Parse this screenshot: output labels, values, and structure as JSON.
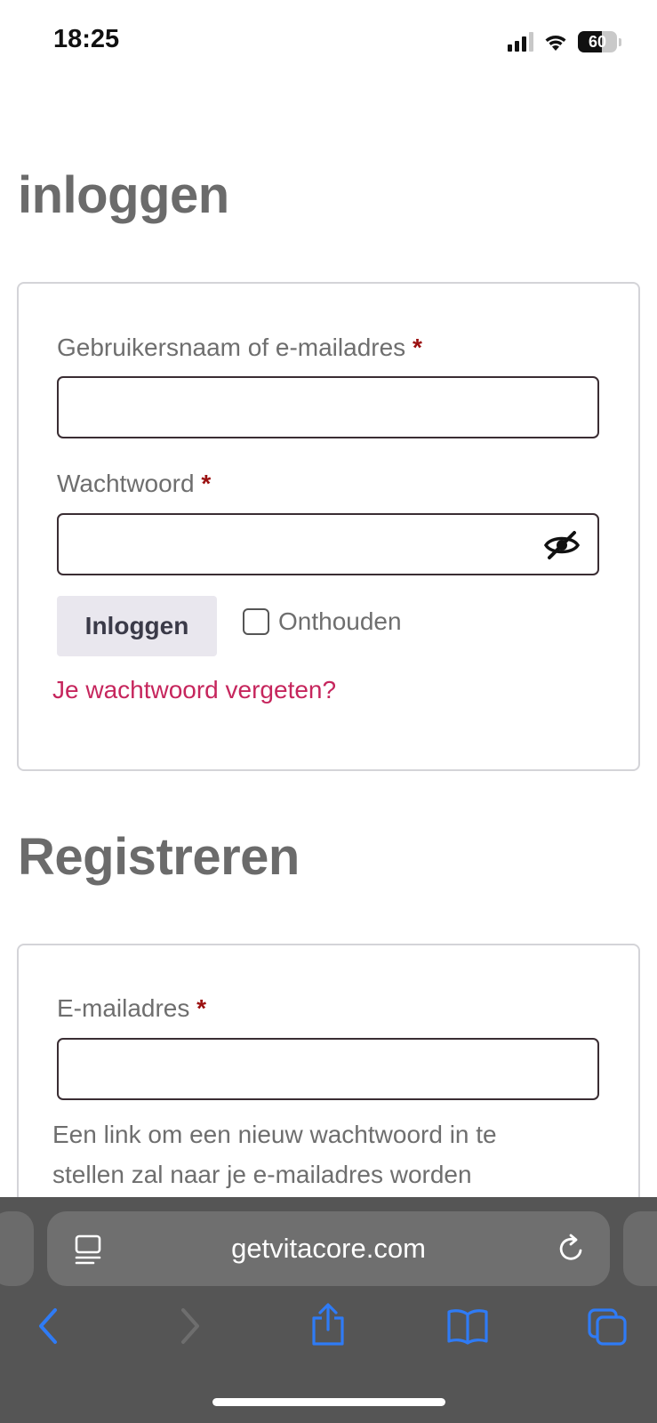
{
  "status_bar": {
    "time": "18:25",
    "battery": "60"
  },
  "login": {
    "title": "inloggen",
    "username_label": "Gebruikersnaam of e-mailadres",
    "password_label": "Wachtwoord",
    "required_marker": "*",
    "username_value": "",
    "password_value": "",
    "login_button": "Inloggen",
    "remember_label": "Onthouden",
    "remember_checked": false,
    "forgot_link": "Je wachtwoord vergeten?"
  },
  "register": {
    "title": "Registreren",
    "email_label": "E-mailadres",
    "required_marker": "*",
    "email_value": "",
    "info_line1": "Een link om een nieuw wachtwoord in te",
    "info_line2": "stellen zal naar je e-mailadres worden"
  },
  "browser": {
    "url": "getvitacore.com",
    "accent_color": "#2f7bf5",
    "icons": [
      "reader-icon",
      "reload-icon",
      "back-icon",
      "forward-icon",
      "share-icon",
      "bookmarks-icon",
      "tabs-icon"
    ]
  }
}
